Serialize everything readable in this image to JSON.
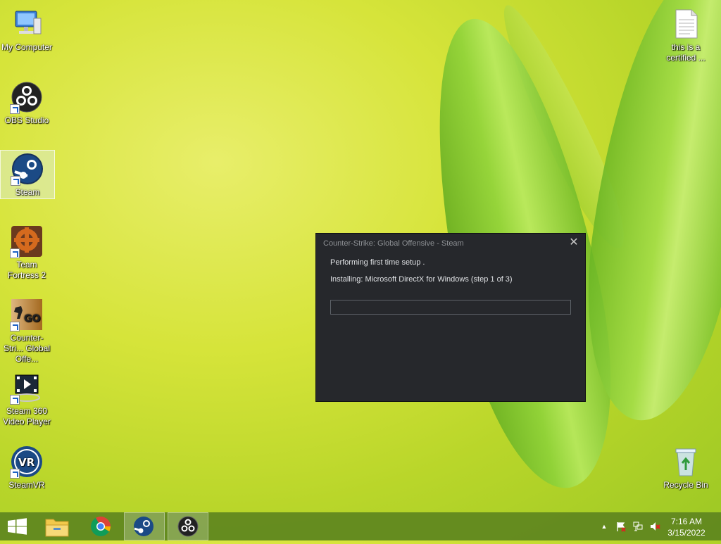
{
  "desktop": {
    "icons_left": [
      {
        "label": "My Computer"
      },
      {
        "label": "OBS Studio"
      },
      {
        "label": "Steam"
      },
      {
        "label": "Team Fortress 2"
      },
      {
        "label": "Counter-Stri... Global Offe..."
      },
      {
        "label": "Steam 360 Video Player"
      },
      {
        "label": "SteamVR"
      }
    ],
    "icons_right": [
      {
        "label": "this is a certified ..."
      },
      {
        "label": "Recycle Bin"
      }
    ]
  },
  "dialog": {
    "title": "Counter-Strike: Global Offensive - Steam",
    "close_glyph": "✕",
    "status": "Performing first time setup .",
    "step": "Installing: Microsoft DirectX for Windows (step 1 of 3)",
    "progress_percent": 0
  },
  "taskbar": {
    "buttons": [
      "start-icon",
      "file-explorer-icon",
      "chrome-icon",
      "steam-icon",
      "obs-icon"
    ],
    "tray_chevron": "▲",
    "clock_time": "7:16 AM",
    "clock_date": "3/15/2022"
  },
  "colors": {
    "dialog_bg": "#26282c",
    "dialog_text": "#dfe1e4",
    "taskbar": "#5e861e"
  }
}
